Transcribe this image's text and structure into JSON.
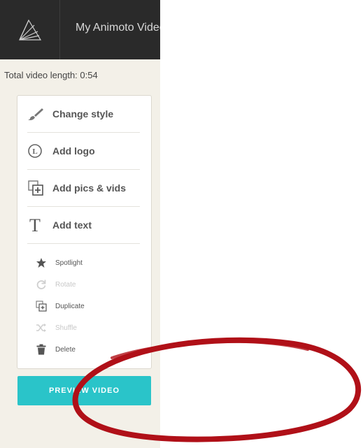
{
  "header": {
    "project_title": "My Animoto Video"
  },
  "summary": {
    "length_text": "Total video length: 0:54"
  },
  "tools": [
    {
      "label": "Change style",
      "icon": "paintbrush-icon"
    },
    {
      "label": "Add logo",
      "icon": "logo-l-icon"
    },
    {
      "label": "Add pics & vids",
      "icon": "add-media-icon"
    },
    {
      "label": "Add text",
      "icon": "text-t-icon"
    }
  ],
  "actions": [
    {
      "label": "Spotlight",
      "icon": "star-icon",
      "enabled": true
    },
    {
      "label": "Rotate",
      "icon": "rotate-icon",
      "enabled": false
    },
    {
      "label": "Duplicate",
      "icon": "duplicate-icon",
      "enabled": true
    },
    {
      "label": "Shuffle",
      "icon": "shuffle-icon",
      "enabled": false
    },
    {
      "label": "Delete",
      "icon": "trash-icon",
      "enabled": true
    }
  ],
  "preview_button": {
    "label": "PREVIEW VIDEO"
  },
  "colors": {
    "accent": "#2ac4c9",
    "topbar": "#2a2a2a",
    "annotation": "#b01018"
  }
}
